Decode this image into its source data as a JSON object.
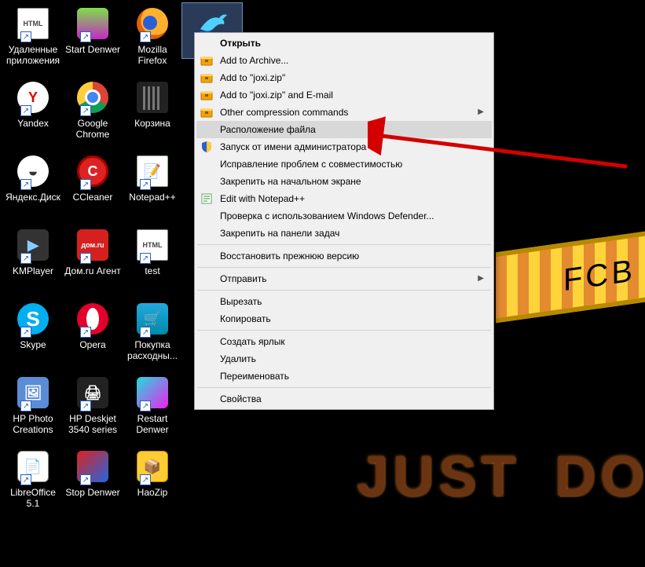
{
  "background": {
    "just": "JUST",
    "do": "DO",
    "fcb": "FCB"
  },
  "selected_icon": {
    "label": "",
    "name": "bird-app"
  },
  "columns": [
    [
      {
        "label": "Удаленные приложения",
        "icon": "html",
        "shortcut": true
      },
      {
        "label": "Yandex",
        "icon": "yandex",
        "shortcut": true
      },
      {
        "label": "Яндекс.Диск",
        "icon": "ydisk",
        "shortcut": true
      },
      {
        "label": "KMPlayer",
        "icon": "kmp",
        "shortcut": true
      },
      {
        "label": "Skype",
        "icon": "skype",
        "shortcut": true
      },
      {
        "label": "HP Photo Creations",
        "icon": "hpphoto",
        "shortcut": true
      },
      {
        "label": "LibreOffice 5.1",
        "icon": "libre",
        "shortcut": true
      }
    ],
    [
      {
        "label": "Start Denwer",
        "icon": "denwer",
        "shortcut": true
      },
      {
        "label": "Google Chrome",
        "icon": "chrome",
        "shortcut": true
      },
      {
        "label": "CCleaner",
        "icon": "ccleaner",
        "shortcut": true
      },
      {
        "label": "Дом.ru Агент",
        "icon": "domru",
        "shortcut": true
      },
      {
        "label": "Opera",
        "icon": "opera",
        "shortcut": true
      },
      {
        "label": "HP Deskjet 3540 series",
        "icon": "printer",
        "shortcut": true
      },
      {
        "label": "Stop Denwer",
        "icon": "stop",
        "shortcut": true
      }
    ],
    [
      {
        "label": "Mozilla Firefox",
        "icon": "firefox",
        "shortcut": true
      },
      {
        "label": "Корзина",
        "icon": "bin",
        "shortcut": false
      },
      {
        "label": "Notepad++",
        "icon": "npp",
        "shortcut": true
      },
      {
        "label": "test",
        "icon": "html",
        "shortcut": true
      },
      {
        "label": "Покупка расходны...",
        "icon": "shop",
        "shortcut": true
      },
      {
        "label": "Restart Denwer",
        "icon": "restart",
        "shortcut": true
      },
      {
        "label": "HaoZip",
        "icon": "haozip",
        "shortcut": true
      }
    ]
  ],
  "context_menu": [
    {
      "type": "item",
      "label": "Открыть",
      "bold": true
    },
    {
      "type": "item",
      "label": "Add to Archive...",
      "icon": "archive"
    },
    {
      "type": "item",
      "label": "Add to \"joxi.zip\"",
      "icon": "archive"
    },
    {
      "type": "item",
      "label": "Add to \"joxi.zip\" and E-mail",
      "icon": "archive"
    },
    {
      "type": "item",
      "label": "Other compression commands",
      "icon": "archive",
      "submenu": true
    },
    {
      "type": "item",
      "label": "Расположение файла",
      "highlight": true
    },
    {
      "type": "item",
      "label": "Запуск от имени администратора",
      "icon": "shield"
    },
    {
      "type": "item",
      "label": "Исправление проблем с совместимостью"
    },
    {
      "type": "item",
      "label": "Закрепить на начальном экране"
    },
    {
      "type": "item",
      "label": "Edit with Notepad++",
      "icon": "npp"
    },
    {
      "type": "item",
      "label": "Проверка с использованием Windows Defender..."
    },
    {
      "type": "item",
      "label": "Закрепить на панели задач"
    },
    {
      "type": "sep"
    },
    {
      "type": "item",
      "label": "Восстановить прежнюю версию"
    },
    {
      "type": "sep"
    },
    {
      "type": "item",
      "label": "Отправить",
      "submenu": true
    },
    {
      "type": "sep"
    },
    {
      "type": "item",
      "label": "Вырезать"
    },
    {
      "type": "item",
      "label": "Копировать"
    },
    {
      "type": "sep"
    },
    {
      "type": "item",
      "label": "Создать ярлык"
    },
    {
      "type": "item",
      "label": "Удалить"
    },
    {
      "type": "item",
      "label": "Переименовать"
    },
    {
      "type": "sep"
    },
    {
      "type": "item",
      "label": "Свойства"
    }
  ],
  "menu_icons": {
    "archive_color": "#f4a300",
    "shield_colors": [
      "#2a5fd6",
      "#ffcc33"
    ]
  }
}
